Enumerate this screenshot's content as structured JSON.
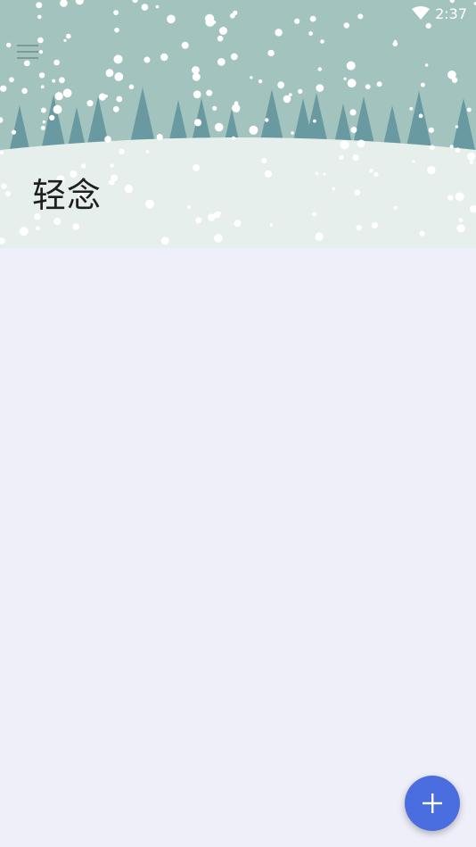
{
  "status_bar": {
    "time": "2:37",
    "wifi_icon": "wifi-icon"
  },
  "toolbar": {
    "menu_icon": "hamburger-menu-icon"
  },
  "header": {
    "title": "轻念",
    "background": "winter-snow-forest-illustration"
  },
  "fab": {
    "icon": "plus-icon"
  },
  "colors": {
    "sky": "#a3c3be",
    "trees": "#6a9aa1",
    "snow_ground": "#e6efec",
    "page_background": "#efeffa",
    "accent": "#4a6ee0"
  }
}
